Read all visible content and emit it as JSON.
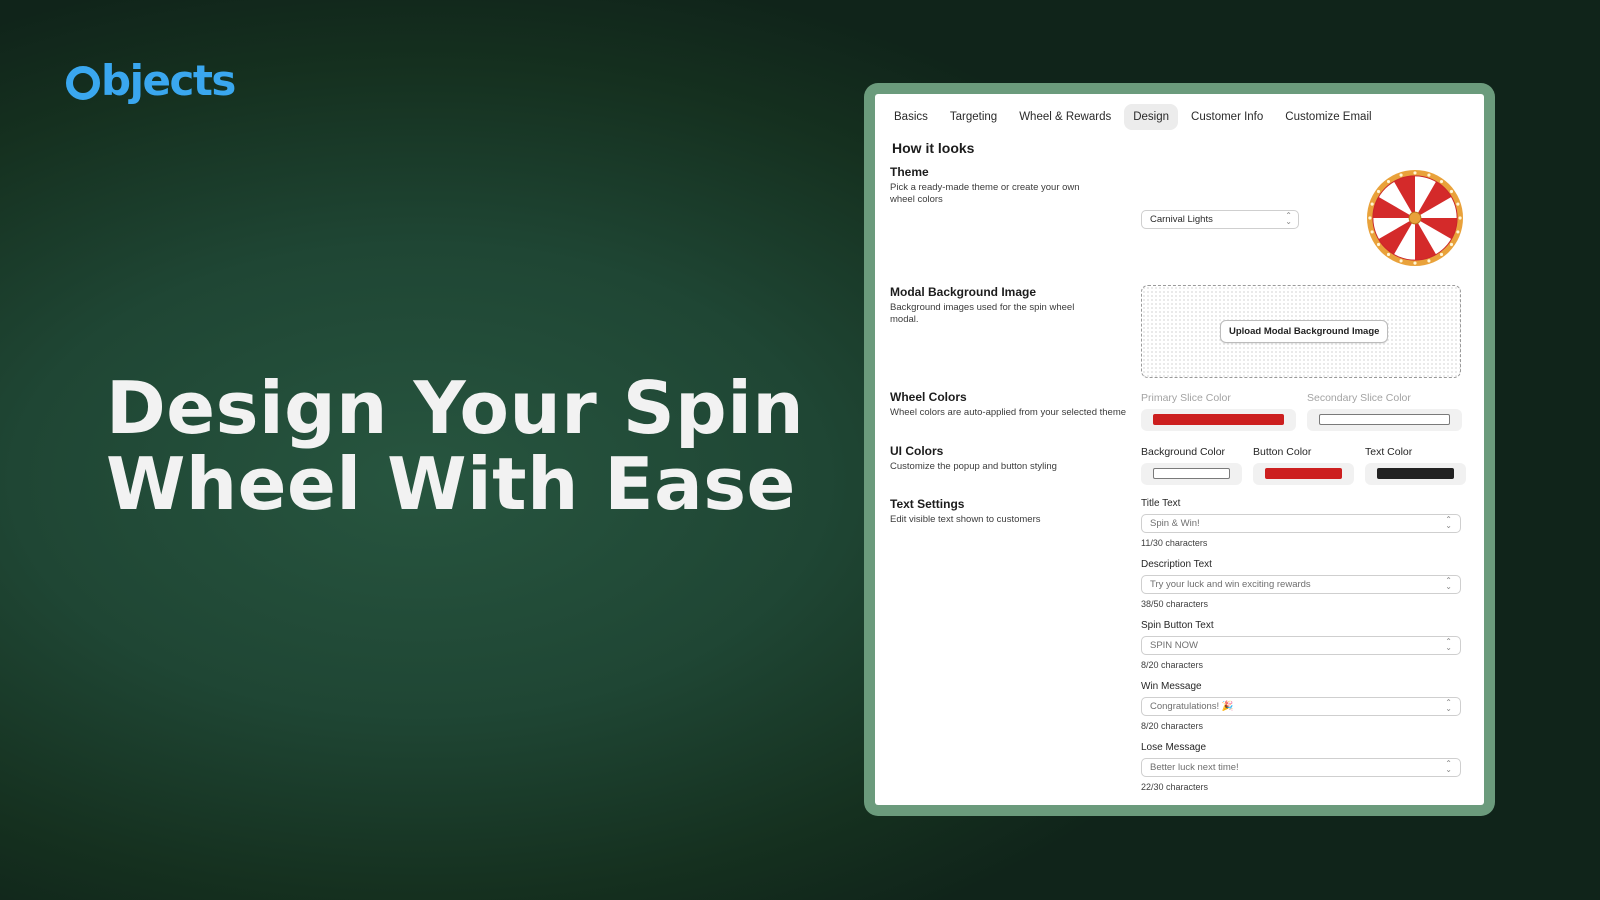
{
  "brand": {
    "logo_text": "bjects",
    "accent": "#3aa7ef"
  },
  "hero": {
    "line1": "Design Your Spin",
    "line2": "Wheel With Ease"
  },
  "tabs": [
    {
      "label": "Basics"
    },
    {
      "label": "Targeting"
    },
    {
      "label": "Wheel & Rewards"
    },
    {
      "label": "Design",
      "active": true
    },
    {
      "label": "Customer Info"
    },
    {
      "label": "Customize Email"
    }
  ],
  "section_title": "How it looks",
  "theme": {
    "title": "Theme",
    "desc": "Pick a ready-made theme or create your own wheel colors",
    "selected": "Carnival Lights",
    "preview_icon": "spin-wheel-preview",
    "wheel_colors": [
      "#d42a2a",
      "#ffffff",
      "#e9a23b"
    ]
  },
  "background_image": {
    "title": "Modal Background Image",
    "desc": "Background images used for the spin wheel modal.",
    "button": "Upload Modal Background Image"
  },
  "wheel_colors": {
    "title": "Wheel Colors",
    "desc": "Wheel colors are auto-applied from your selected theme",
    "primary_label": "Primary Slice Color",
    "secondary_label": "Secondary Slice Color",
    "primary": "#cc1f1f",
    "secondary": "#ffffff"
  },
  "ui_colors": {
    "title": "UI Colors",
    "desc": "Customize the popup and button styling",
    "background_label": "Background Color",
    "button_label": "Button Color",
    "text_label": "Text Color",
    "background": "#ffffff",
    "button": "#cc1f1f",
    "text": "#222222"
  },
  "text_settings": {
    "title": "Text Settings",
    "desc": "Edit visible text shown to customers",
    "fields": [
      {
        "label": "Title Text",
        "value": "Spin & Win!",
        "count": "11/30 characters"
      },
      {
        "label": "Description Text",
        "value": "Try your luck and win exciting rewards",
        "count": "38/50 characters"
      },
      {
        "label": "Spin Button Text",
        "value": "SPIN NOW",
        "count": "8/20 characters"
      },
      {
        "label": "Win Message",
        "value": "Congratulations! 🎉",
        "count": "8/20 characters"
      },
      {
        "label": "Lose Message",
        "value": "Better luck next time!",
        "count": "22/30 characters"
      }
    ]
  }
}
